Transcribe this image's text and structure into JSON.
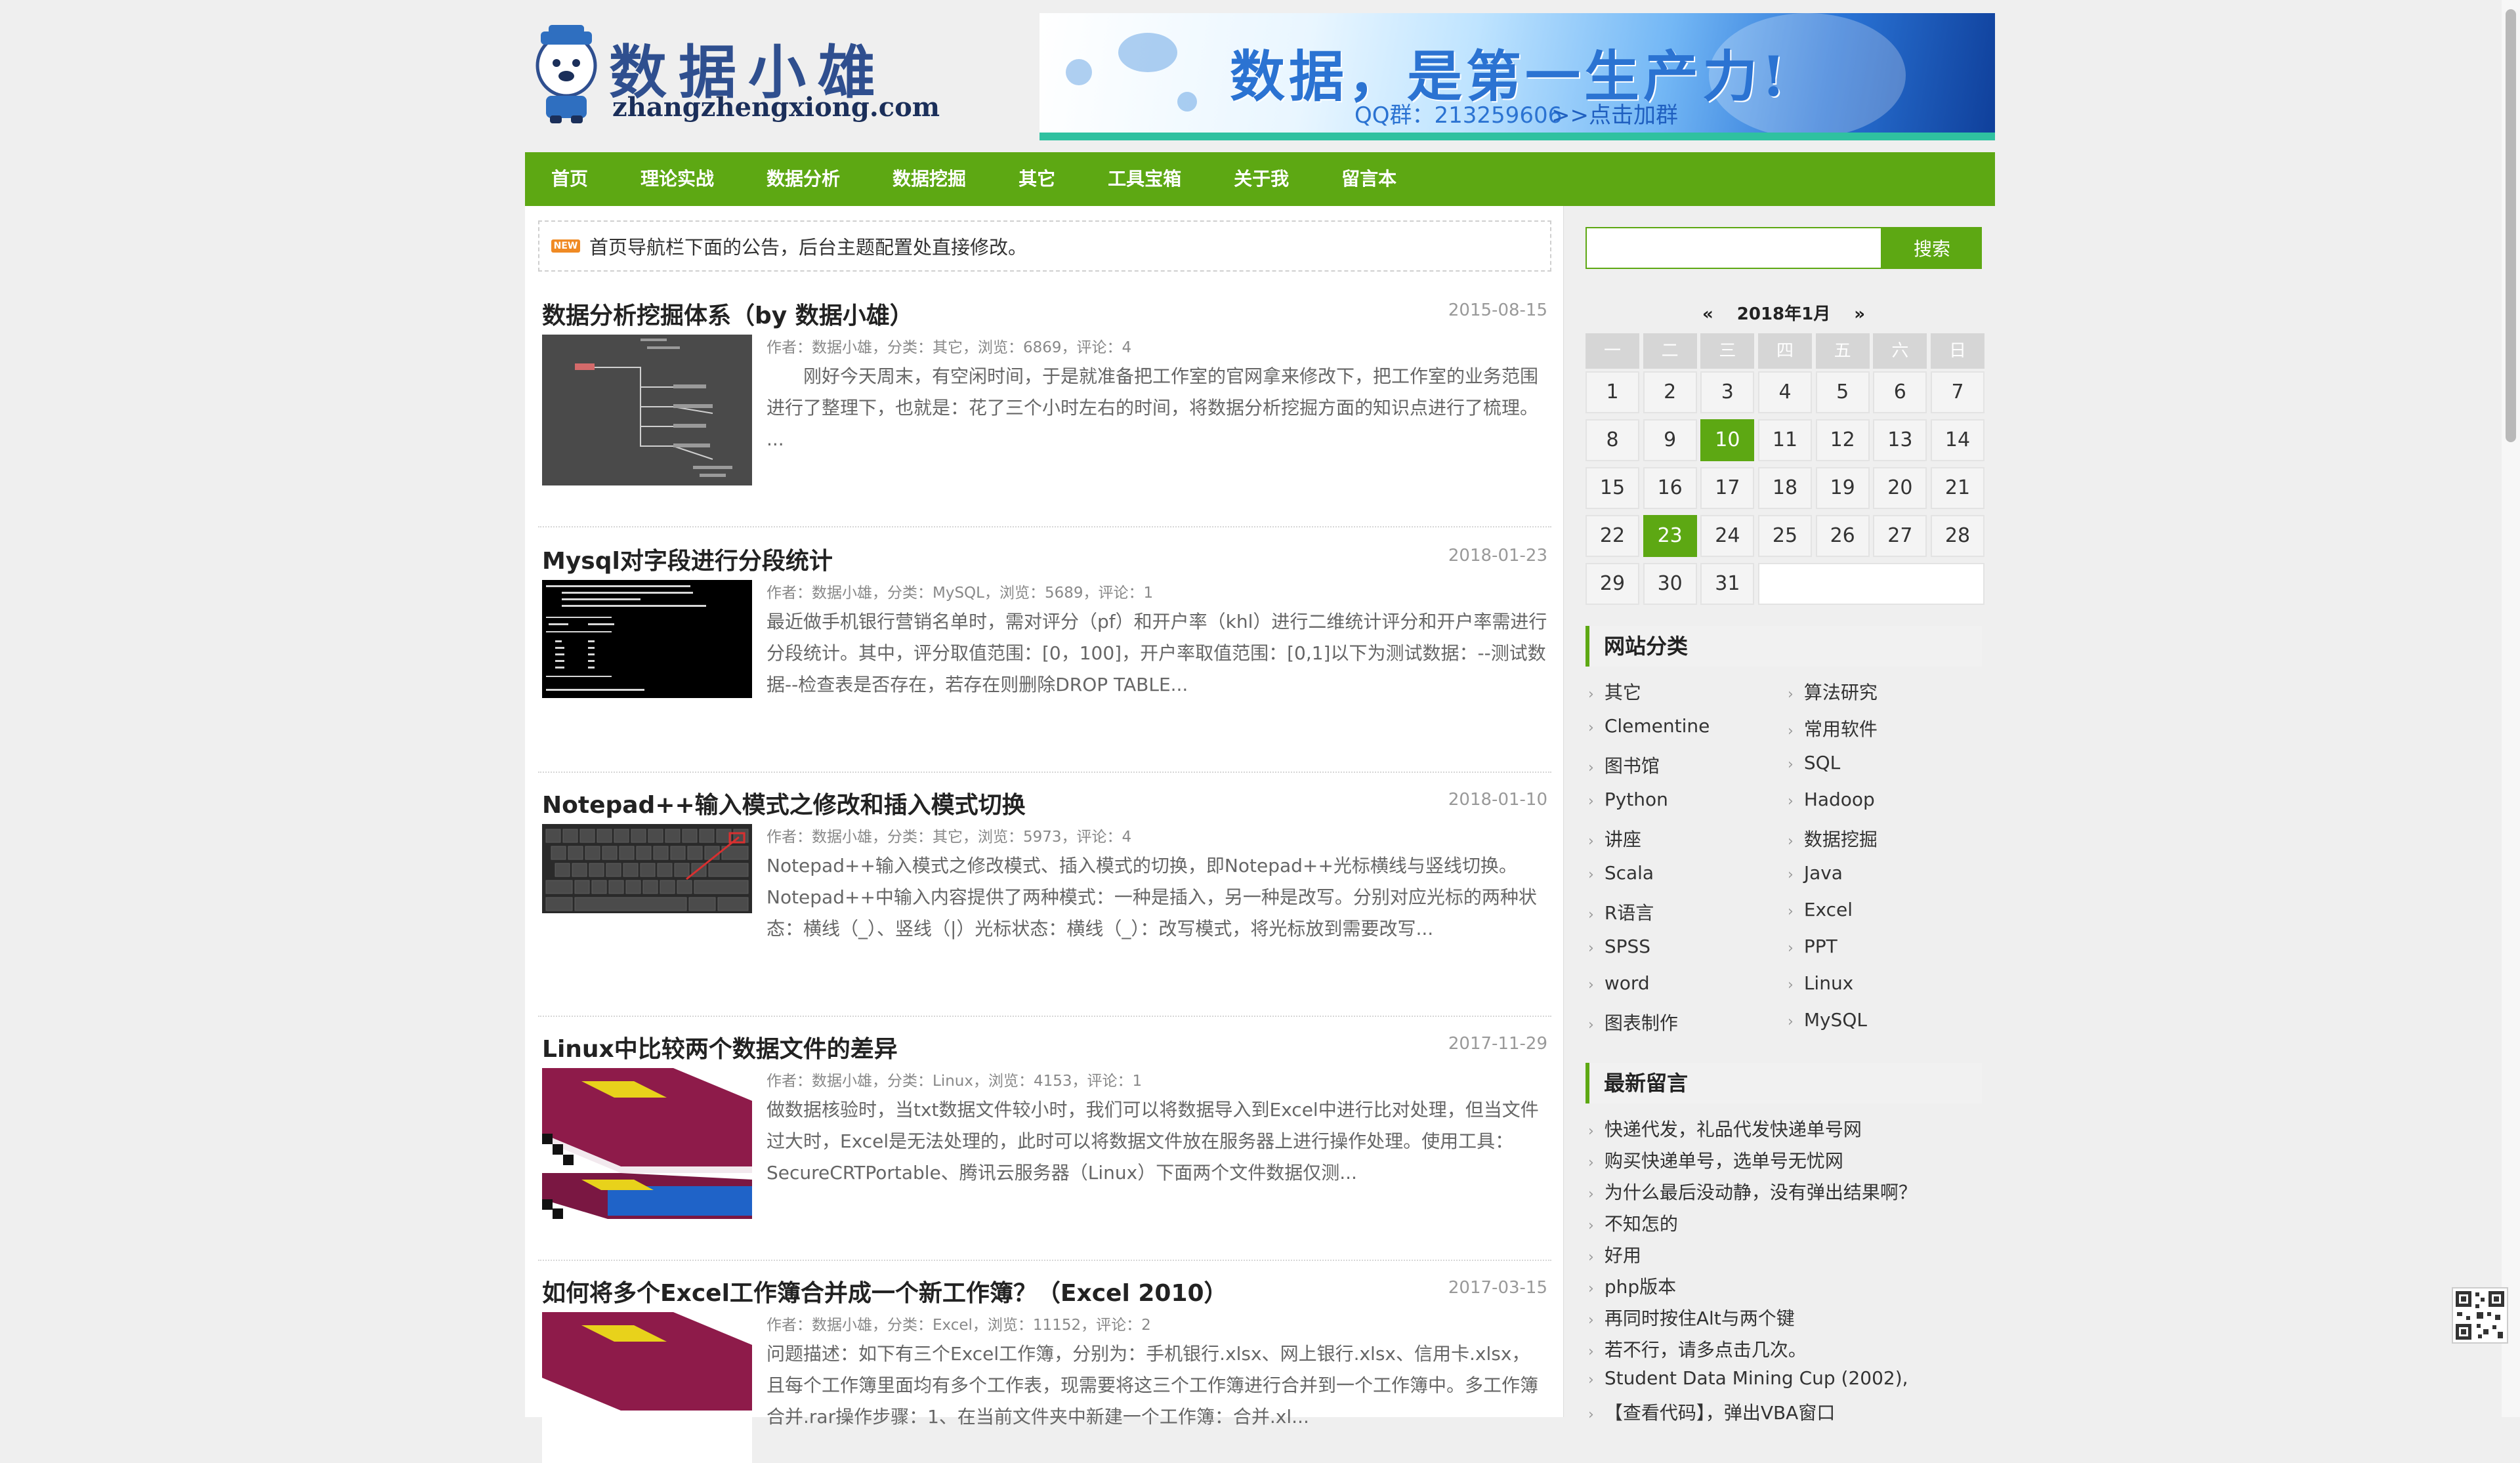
{
  "site": {
    "logo_cn": "数据小雄",
    "logo_url": "zhangzhengxiong.com",
    "banner": {
      "headline": "数据，是第一生产力!",
      "qq": "QQ群：213259606",
      "join": ">>点击加群"
    }
  },
  "nav": {
    "items": [
      "首页",
      "理论实战",
      "数据分析",
      "数据挖掘",
      "其它",
      "工具宝箱",
      "关于我",
      "留言本"
    ]
  },
  "notice": {
    "badge": "NEW",
    "text": "首页导航栏下面的公告，后台主题配置处直接修改。"
  },
  "posts": [
    {
      "title": "数据分析挖掘体系（by 数据小雄）",
      "date": "2015-08-15",
      "meta": "作者：数据小雄，分类：其它，浏览：6869，评论：4",
      "excerpt": "　　刚好今天周末，有空闲时间，于是就准备把工作室的官网拿来修改下，把工作室的业务范围进行了整理下，也就是：花了三个小时左右的时间，将数据分析挖掘方面的知识点进行了梳理。 ..."
    },
    {
      "title": "Mysql对字段进行分段统计",
      "date": "2018-01-23",
      "meta": "作者：数据小雄，分类：MySQL，浏览：5689，评论：1",
      "excerpt": "最近做手机银行营销名单时，需对评分（pf）和开户率（khl）进行二维统计评分和开户率需进行分段统计。其中，评分取值范围：[0，100]，开户率取值范围：[0,1]以下为测试数据：--测试数据--检查表是否存在，若存在则删除DROP TABLE..."
    },
    {
      "title": "Notepad++输入模式之修改和插入模式切换",
      "date": "2018-01-10",
      "meta": "作者：数据小雄，分类：其它，浏览：5973，评论：4",
      "excerpt": "Notepad++输入模式之修改模式、插入模式的切换，即Notepad++光标横线与竖线切换。Notepad++中输入内容提供了两种模式：一种是插入，另一种是改写。分别对应光标的两种状态：横线（_）、竖线（|）光标状态：横线（_）：改写模式，将光标放到需要改写..."
    },
    {
      "title": "Linux中比较两个数据文件的差异",
      "date": "2017-11-29",
      "meta": "作者：数据小雄，分类：Linux，浏览：4153，评论：1",
      "excerpt": "做数据核验时，当txt数据文件较小时，我们可以将数据导入到Excel中进行比对处理，但当文件过大时，Excel是无法处理的，此时可以将数据文件放在服务器上进行操作处理。使用工具：SecureCRTPortable、腾讯云服务器（Linux）下面两个文件数据仅测..."
    },
    {
      "title": "如何将多个Excel工作簿合并成一个新工作簿？（Excel 2010）",
      "date": "2017-03-15",
      "meta": "作者：数据小雄，分类：Excel，浏览：11152，评论：2",
      "excerpt": "问题描述：如下有三个Excel工作簿，分别为：手机银行.xlsx、网上银行.xlsx、信用卡.xlsx，且每个工作簿里面均有多个工作表，现需要将这三个工作簿进行合并到一个工作簿中。多工作簿合并.rar操作步骤：1、在当前文件夹中新建一个工作簿：合并.xl..."
    }
  ],
  "sidebar": {
    "search": {
      "placeholder": "",
      "button": "搜索"
    },
    "calendar": {
      "prev": "«",
      "title": "2018年1月",
      "next": "»",
      "weekdays": [
        "一",
        "二",
        "三",
        "四",
        "五",
        "六",
        "日"
      ],
      "days": [
        1,
        2,
        3,
        4,
        5,
        6,
        7,
        8,
        9,
        10,
        11,
        12,
        13,
        14,
        15,
        16,
        17,
        18,
        19,
        20,
        21,
        22,
        23,
        24,
        25,
        26,
        27,
        28,
        29,
        30,
        31
      ],
      "highlighted": [
        10,
        23
      ]
    },
    "categories_title": "网站分类",
    "categories": [
      [
        "其它",
        "算法研究"
      ],
      [
        "Clementine",
        "常用软件"
      ],
      [
        "图书馆",
        "SQL"
      ],
      [
        "Python",
        "Hadoop"
      ],
      [
        "讲座",
        "数据挖掘"
      ],
      [
        "Scala",
        "Java"
      ],
      [
        "R语言",
        "Excel"
      ],
      [
        "SPSS",
        "PPT"
      ],
      [
        "word",
        "Linux"
      ],
      [
        "图表制作",
        "MySQL"
      ]
    ],
    "messages_title": "最新留言",
    "messages": [
      "快递代发，礼品代发快递单号网",
      "购买快递单号，选单号无忧网",
      "为什么最后没动静，没有弹出结果啊？",
      "不知怎的",
      "好用",
      "php版本",
      "再同时按住Alt与两个键",
      "若不行，请多点击几次。",
      "Student Data Mining Cup (2002),",
      "【查看代码】，弹出VBA窗口"
    ]
  },
  "icons": {
    "chevron": "chevron-right-icon",
    "mascot": "bear-mascot-icon",
    "qr": "qr-code-icon"
  },
  "colors": {
    "accent": "#5da813",
    "badge": "#f08a24",
    "banner_blue": "#2b73d2"
  }
}
